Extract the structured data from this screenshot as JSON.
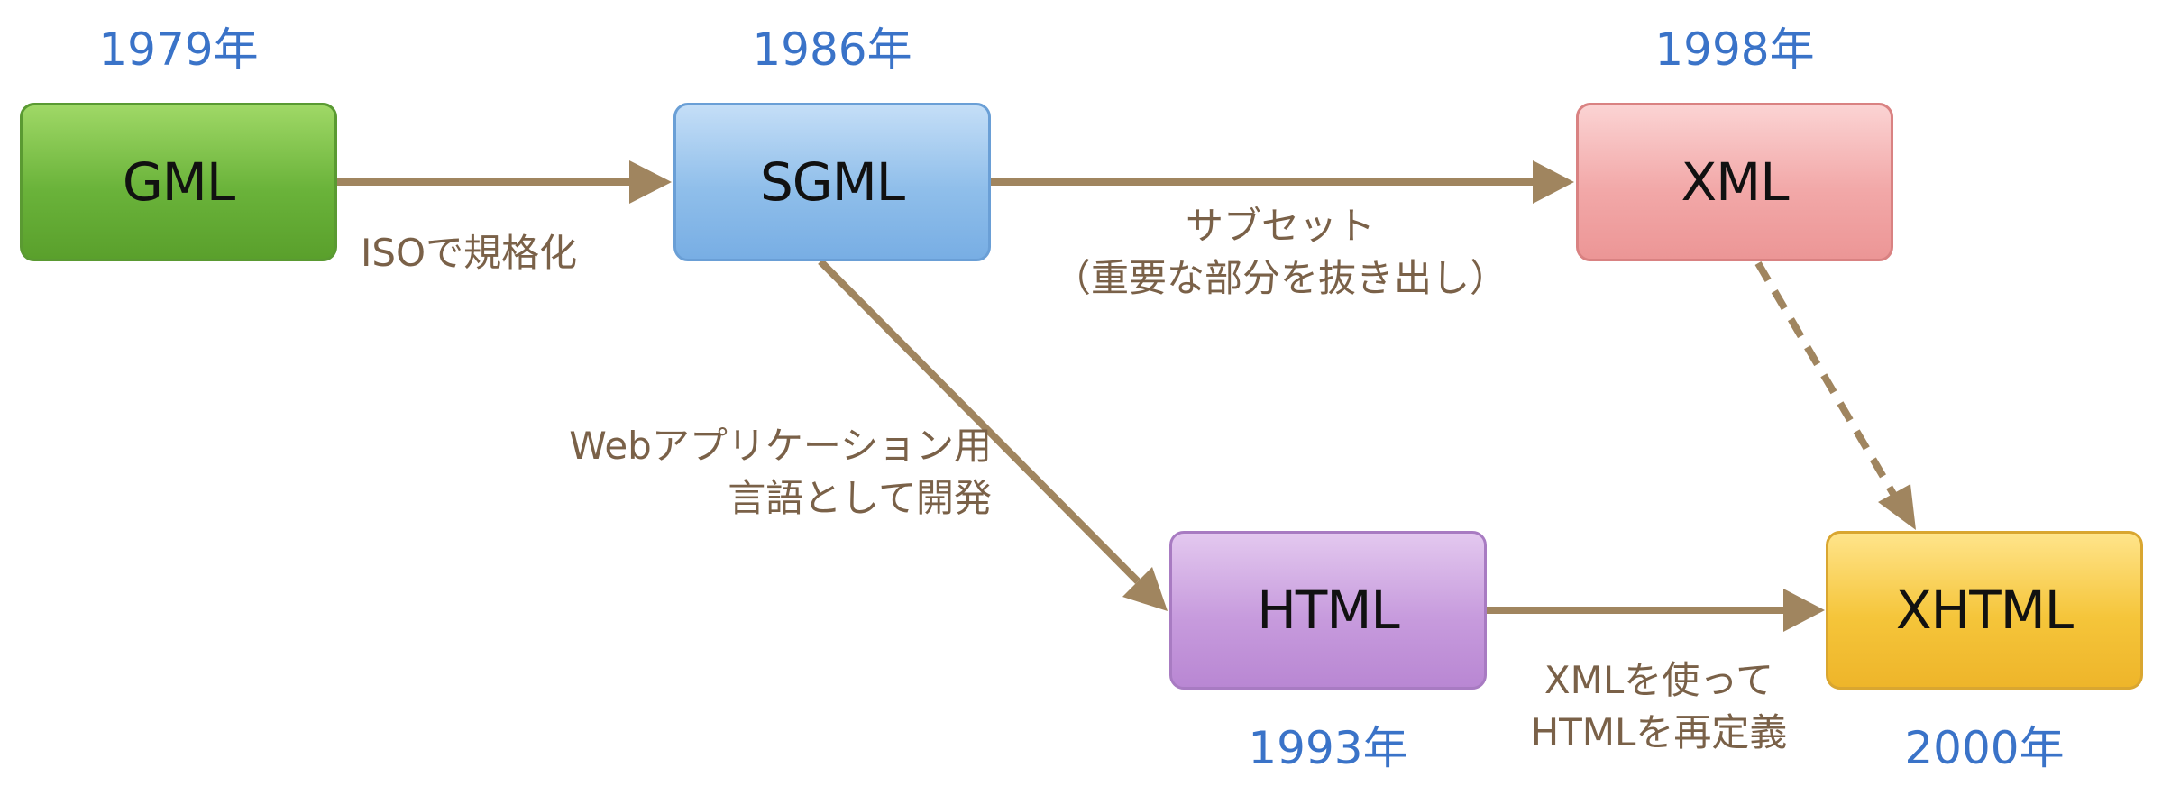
{
  "colors": {
    "year_text": "#3a73c8",
    "arrow": "#a0855f",
    "label_text": "#7a6148"
  },
  "nodes": {
    "gml": {
      "label": "GML",
      "year": "1979年",
      "color": "#6ab33a"
    },
    "sgml": {
      "label": "SGML",
      "year": "1986年",
      "color": "#8fbeea"
    },
    "xml": {
      "label": "XML",
      "year": "1998年",
      "color": "#f2a8a8"
    },
    "html": {
      "label": "HTML",
      "year": "1993年",
      "color": "#c79bdd"
    },
    "xhtml": {
      "label": "XHTML",
      "year": "2000年",
      "color": "#f5c53a"
    }
  },
  "edges": {
    "gml_sgml": {
      "label": "ISOで規格化"
    },
    "sgml_xml": {
      "line1": "サブセット",
      "line2": "（重要な部分を抜き出し）"
    },
    "sgml_html": {
      "line1": "Webアプリケーション用",
      "line2": "言語として開発"
    },
    "html_xhtml": {
      "line1": "XMLを使って",
      "line2": "HTMLを再定義"
    },
    "xml_xhtml": {
      "style": "dashed"
    }
  }
}
